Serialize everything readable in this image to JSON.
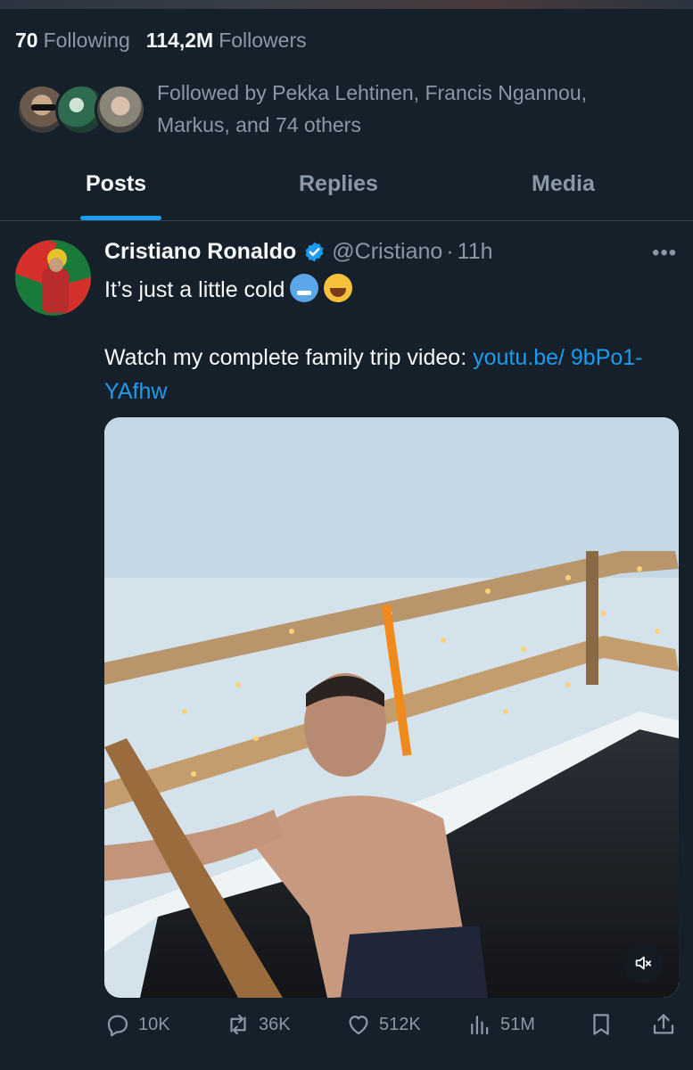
{
  "profile": {
    "following_count": "70",
    "following_label": "Following",
    "followers_count": "114,2M",
    "followers_label": "Followers",
    "followed_by_text": "Followed by Pekka Lehtinen, Francis Ngannou, Markus, and 74 others"
  },
  "tabs": [
    {
      "label": "Posts",
      "active": true
    },
    {
      "label": "Replies",
      "active": false
    },
    {
      "label": "Media",
      "active": false
    }
  ],
  "post": {
    "author": "Cristiano Ronaldo",
    "handle": "@Cristiano",
    "separator": "·",
    "time": "11h",
    "text_line1": "It’s just a little cold",
    "text_line2": "Watch my complete family trip video:",
    "link": "youtu.be/ 9bPo1-YAfhw",
    "emojis": [
      "cold-face-emoji",
      "tears-of-joy-emoji"
    ],
    "media": {
      "type": "video",
      "muted": true
    },
    "metrics": {
      "replies": "10K",
      "reposts": "36K",
      "likes": "512K",
      "views": "51M"
    }
  },
  "colors": {
    "background": "#15202b",
    "accent": "#1d9bf0",
    "secondary_text": "#8b98a5",
    "divider": "#38444d"
  }
}
